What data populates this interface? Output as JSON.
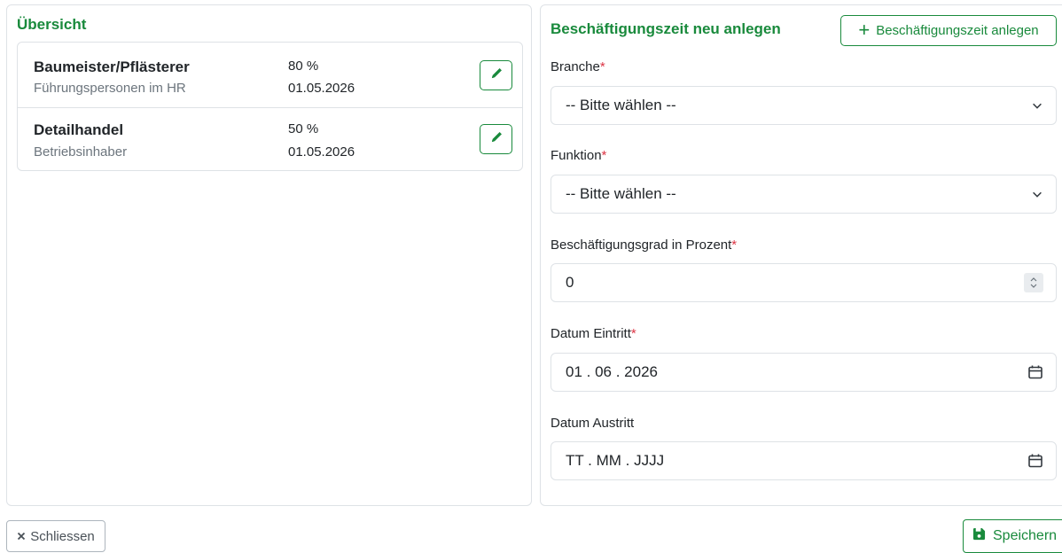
{
  "overview": {
    "title": "Übersicht",
    "entries": [
      {
        "title": "Baumeister/Pflästerer",
        "subtitle": "Führungspersonen im HR",
        "percent": "80 %",
        "date": "01.05.2026"
      },
      {
        "title": "Detailhandel",
        "subtitle": "Betriebsinhaber",
        "percent": "50 %",
        "date": "01.05.2026"
      }
    ]
  },
  "form": {
    "title": "Beschäftigungszeit neu anlegen",
    "add_button_label": "Beschäftigungszeit anlegen",
    "branche": {
      "label": "Branche",
      "required_mark": "*",
      "value": "-- Bitte wählen --"
    },
    "funktion": {
      "label": "Funktion",
      "required_mark": "*",
      "value": "-- Bitte wählen --"
    },
    "grad": {
      "label": "Beschäftigungsgrad in Prozent",
      "required_mark": "*",
      "value": "0"
    },
    "eintritt": {
      "label": "Datum Eintritt",
      "required_mark": "*",
      "value": "01 . 06 . 2026"
    },
    "austritt": {
      "label": "Datum Austritt",
      "value": "TT . MM . JJJJ"
    }
  },
  "footer": {
    "close_label": "Schliessen",
    "save_label": "Speichern"
  },
  "colors": {
    "accent": "#198a3c",
    "required": "#dc3545",
    "border": "#dee2e6"
  },
  "icons": [
    "pencil-icon",
    "plus-icon",
    "chevron-down-icon",
    "calendar-icon",
    "close-icon",
    "save-icon"
  ]
}
